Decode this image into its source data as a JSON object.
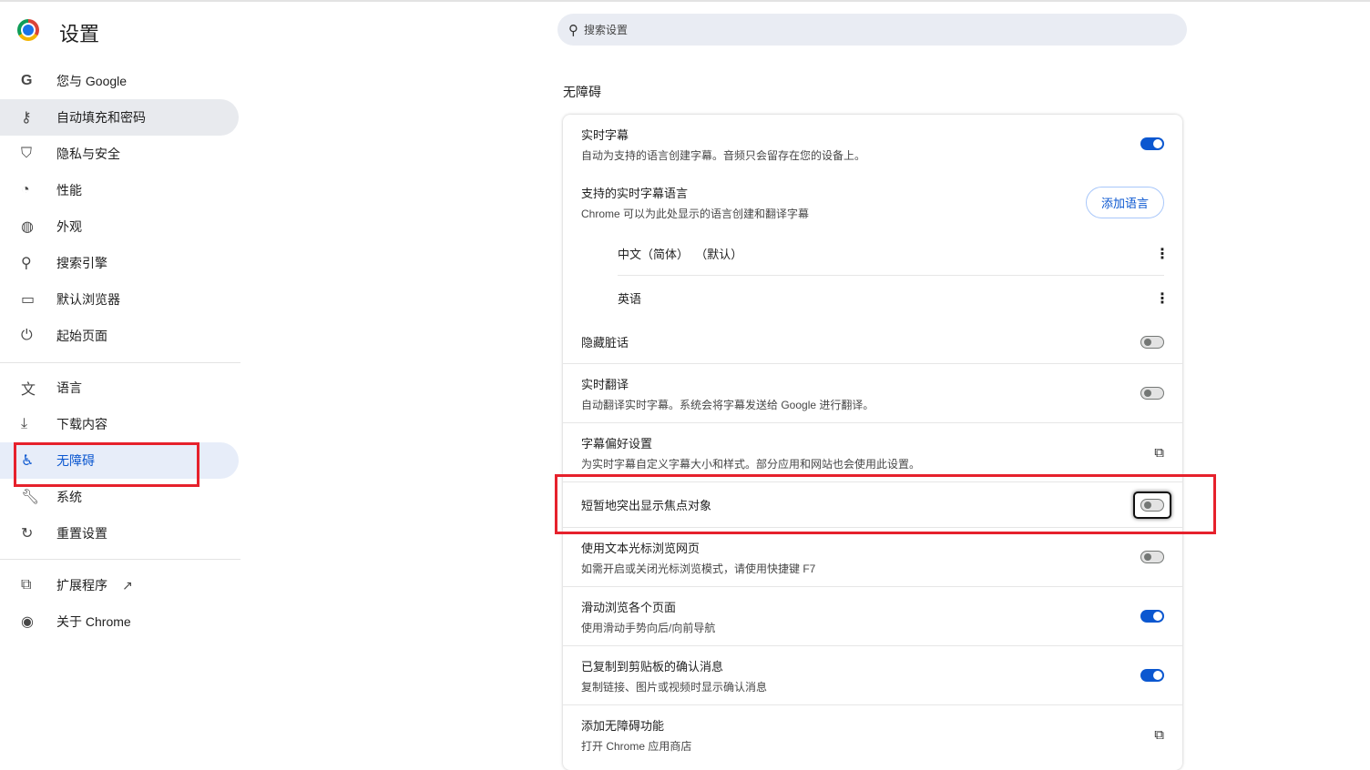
{
  "app": {
    "title": "设置"
  },
  "search": {
    "placeholder": "搜索设置"
  },
  "sidebar": {
    "items": [
      {
        "label": "您与 Google",
        "icon": "google-icon"
      },
      {
        "label": "自动填充和密码",
        "icon": "key-icon"
      },
      {
        "label": "隐私与安全",
        "icon": "shield-icon"
      },
      {
        "label": "性能",
        "icon": "speedometer-icon"
      },
      {
        "label": "外观",
        "icon": "palette-icon"
      },
      {
        "label": "搜索引擎",
        "icon": "search-icon"
      },
      {
        "label": "默认浏览器",
        "icon": "browser-icon"
      },
      {
        "label": "起始页面",
        "icon": "power-icon"
      },
      {
        "label": "语言",
        "icon": "translate-icon"
      },
      {
        "label": "下载内容",
        "icon": "download-icon"
      },
      {
        "label": "无障碍",
        "icon": "accessibility-icon"
      },
      {
        "label": "系统",
        "icon": "wrench-icon"
      },
      {
        "label": "重置设置",
        "icon": "reset-icon"
      },
      {
        "label": "扩展程序",
        "icon": "extension-icon"
      },
      {
        "label": "关于 Chrome",
        "icon": "chrome-icon"
      }
    ]
  },
  "section": {
    "title": "无障碍"
  },
  "settings": {
    "live_caption": {
      "title": "实时字幕",
      "desc": "自动为支持的语言创建字幕。音频只会留存在您的设备上。",
      "on": true
    },
    "languages": {
      "title": "支持的实时字幕语言",
      "desc": "Chrome 可以为此处显示的语言创建和翻译字幕",
      "button": "添加语言",
      "items": [
        "中文（简体）  （默认）",
        "英语"
      ]
    },
    "mask_profanity": {
      "title": "隐藏脏话",
      "on": false
    },
    "live_translate": {
      "title": "实时翻译",
      "desc": "自动翻译实时字幕。系统会将字幕发送给 Google 进行翻译。",
      "on": false
    },
    "caption_prefs": {
      "title": "字幕偏好设置",
      "desc": "为实时字幕自定义字幕大小和样式。部分应用和网站也会使用此设置。"
    },
    "focus_highlight": {
      "title": "短暂地突出显示焦点对象",
      "on": false
    },
    "caret_browsing": {
      "title": "使用文本光标浏览网页",
      "desc": "如需开启或关闭光标浏览模式，请使用快捷键 F7",
      "on": false
    },
    "swipe_nav": {
      "title": "滑动浏览各个页面",
      "desc": "使用滑动手势向后/向前导航",
      "on": true
    },
    "clipboard": {
      "title": "已复制到剪贴板的确认消息",
      "desc": "复制链接、图片或视频时显示确认消息",
      "on": true
    },
    "add_features": {
      "title": "添加无障碍功能",
      "desc": "打开 Chrome 应用商店"
    }
  },
  "colors": {
    "accent": "#0b57d0",
    "highlight": "#e6212c"
  }
}
